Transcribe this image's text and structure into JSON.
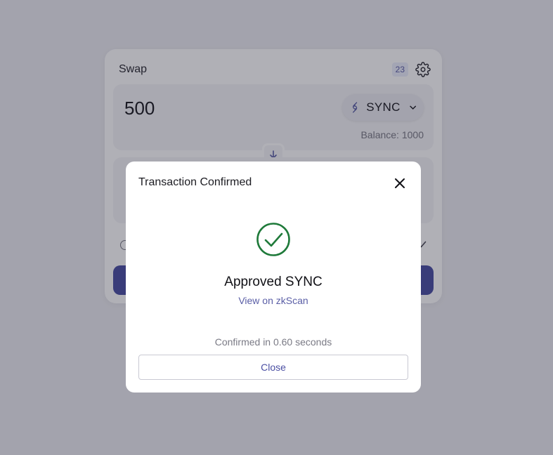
{
  "swap": {
    "title": "Swap",
    "badge": "23",
    "from": {
      "amount": "500",
      "token": "SYNC",
      "balance": "Balance: 1000"
    }
  },
  "modal": {
    "title": "Transaction Confirmed",
    "status": "Approved SYNC",
    "link_text": "View on zkScan",
    "confirm_text": "Confirmed in 0.60 seconds",
    "close_label": "Close"
  },
  "colors": {
    "accent": "#4b4fa3",
    "success": "#1f7a3a",
    "overlay": "#16162a"
  },
  "icons": [
    "gear-icon",
    "sync-token-icon",
    "chevron-down-icon",
    "arrow-down-icon",
    "close-icon",
    "success-check-icon"
  ]
}
